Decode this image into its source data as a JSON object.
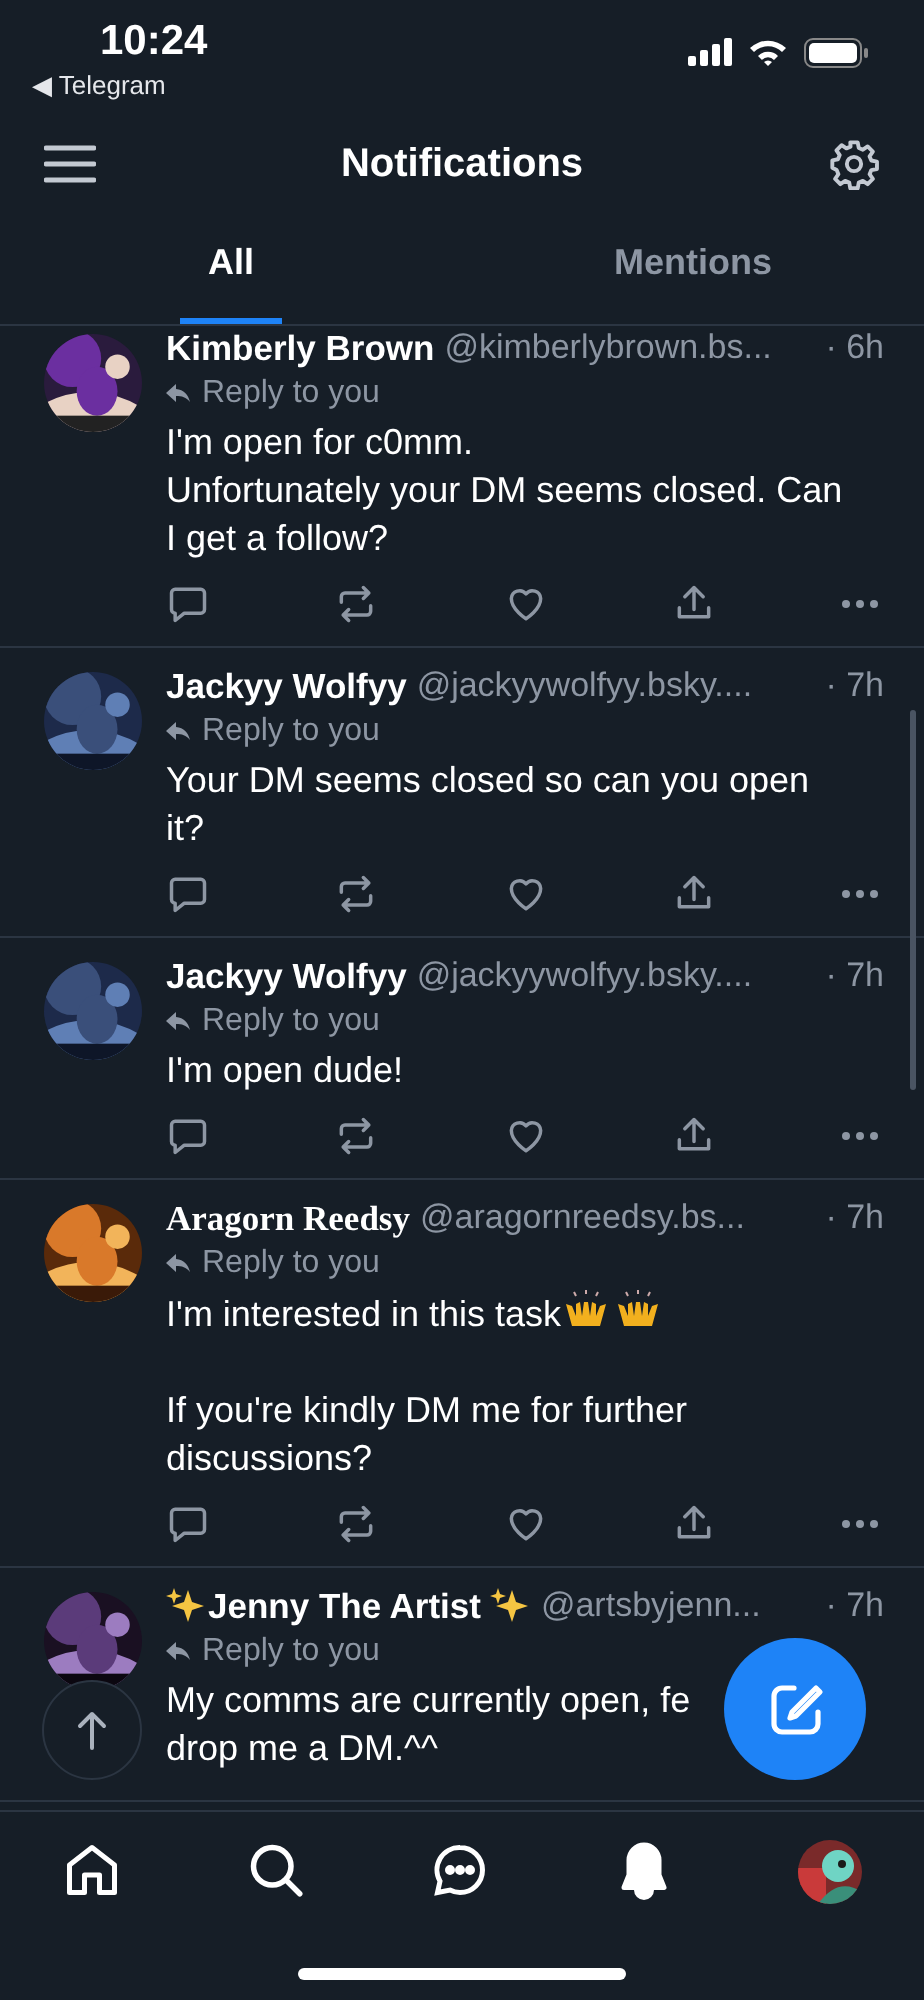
{
  "status_bar": {
    "time": "10:24",
    "back_app": "◀ Telegram"
  },
  "header": {
    "title": "Notifications"
  },
  "tabs": [
    {
      "label": "All",
      "selected": true
    },
    {
      "label": "Mentions",
      "selected": false
    }
  ],
  "notifications": [
    {
      "name": "Kimberly Brown",
      "kind": "plain",
      "handle": "@kimberlybrown.bs...",
      "time": "· 6h",
      "reply_label": "Reply to you",
      "body": "I'm open for c0mm.\nUnfortunately your DM seems closed. Can I get a follow?",
      "show_actions": true
    },
    {
      "name": "Jackyy Wolfyy",
      "kind": "plain",
      "handle": "@jackyywolfyy.bsky....",
      "time": "· 7h",
      "reply_label": "Reply to you",
      "body": "Your DM seems closed so can you open it?",
      "show_actions": true
    },
    {
      "name": "Jackyy Wolfyy",
      "kind": "plain",
      "handle": "@jackyywolfyy.bsky....",
      "time": "· 7h",
      "reply_label": "Reply to you",
      "body": "I'm open dude!",
      "show_actions": true
    },
    {
      "name": "Aragorn Reedsy",
      "kind": "serif",
      "handle": "@aragornreedsy.bs...",
      "time": "· 7h",
      "reply_label": "Reply to you",
      "body": "I'm interested in this task",
      "body_extras": [
        {
          "kind": "raised-hands"
        },
        {
          "kind": "raised-hands"
        }
      ],
      "body_2": "If you're kindly DM me for further discussions?",
      "show_actions": true
    },
    {
      "name": "Jenny The Artist",
      "kind": "sparkles",
      "handle": "@artsbyjenn...",
      "time": "· 7h",
      "reply_label": "Reply to you",
      "body": "My comms are currently open, fe\ndrop me a DM.^^",
      "show_actions": false
    }
  ],
  "bottom_nav": [
    {
      "kind": "home",
      "selected": false
    },
    {
      "kind": "search",
      "selected": false
    },
    {
      "kind": "chat",
      "selected": false
    },
    {
      "kind": "bell",
      "selected": true
    },
    {
      "kind": "avatar",
      "selected": false
    }
  ]
}
